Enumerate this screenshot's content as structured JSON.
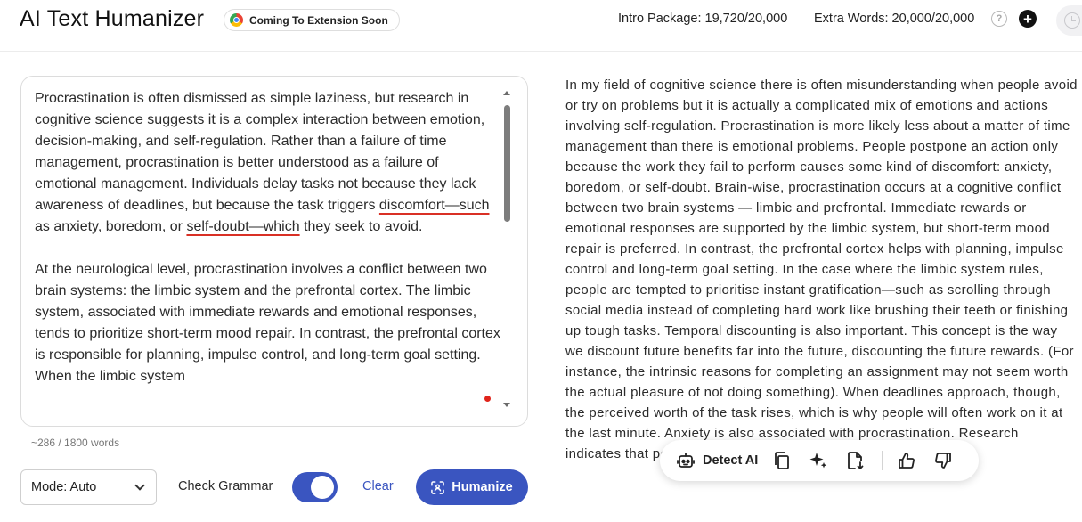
{
  "header": {
    "title": "AI Text Humanizer",
    "extension_badge": "Coming To Extension Soon",
    "intro_package": "Intro Package: 19,720/20,000",
    "extra_words": "Extra Words: 20,000/20,000",
    "help_symbol": "?",
    "plus_symbol": "+"
  },
  "input": {
    "paragraphs": [
      {
        "before_error1": "Procrastination is often dismissed as simple laziness, but research in cognitive science suggests it is a complex interaction between emotion, decision-making, and self-regulation. Rather than a failure of time management, procrastination is better understood as a failure of emotional management. Individuals delay tasks not because they lack awareness of deadlines, but because the task triggers ",
        "error1": "discomfort—such",
        "between": " as anxiety, boredom, or ",
        "error2": "self-doubt—which",
        "after": " they seek to avoid."
      },
      "At the neurological level, procrastination involves a conflict between two brain systems: the limbic system and the prefrontal cortex. The limbic system, associated with immediate rewards and emotional responses, tends to prioritize short-term mood repair. In contrast, the prefrontal cortex is responsible for planning, impulse control, and long-term goal setting. When the limbic system"
    ],
    "word_count": "~286 / 1800 words"
  },
  "controls": {
    "mode": "Mode: Auto",
    "grammar_label": "Check Grammar",
    "grammar_on": true,
    "clear_label": "Clear",
    "humanize_label": "Humanize"
  },
  "output": {
    "text": "In my field of cognitive science there is often misunderstanding when people avoid or try on problems but it is actually a complicated mix of emotions and actions involving self-regulation. Procrastination is more likely less about a matter of time management than there is emotional problems. People postpone an action only because the work they fail to perform causes some kind of discomfort: anxiety, boredom, or self-doubt. Brain-wise, procrastination occurs at a cognitive conflict between two brain systems — limbic and prefrontal. Immediate rewards or emotional responses are supported by the limbic system, but short-term mood repair is preferred. In contrast, the prefrontal cortex helps with planning, impulse control and long-term goal setting. In the case where the limbic system rules, people are tempted to prioritise instant gratification—such as scrolling through social media instead of completing hard work like brushing their teeth or finishing up tough tasks. Temporal discounting is also important. This concept is the way we discount future benefits far into the future, discounting the future rewards. (For instance, the intrinsic reasons for completing an assignment may not seem worth the actual pleasure of not doing something). When deadlines approach, though, the perceived worth of the task rises, which is why people will often work on it at the last minute. Anxiety is also associated with procrastination. Research indicates that people who are extremely self-"
  },
  "toolbar": {
    "detect_label": "Detect AI"
  },
  "icons": {
    "extension": "chrome-icon",
    "help": "question-circle-icon",
    "add": "plus-circle-icon",
    "history": "history-icon",
    "detect": "robot-icon",
    "copy": "copy-icon",
    "sparkle": "sparkle-icon",
    "download": "file-download-icon",
    "like": "thumbs-up-icon",
    "dislike": "thumbs-down-icon"
  },
  "colors": {
    "accent": "#3a55c0",
    "spell_error": "#d93025"
  }
}
